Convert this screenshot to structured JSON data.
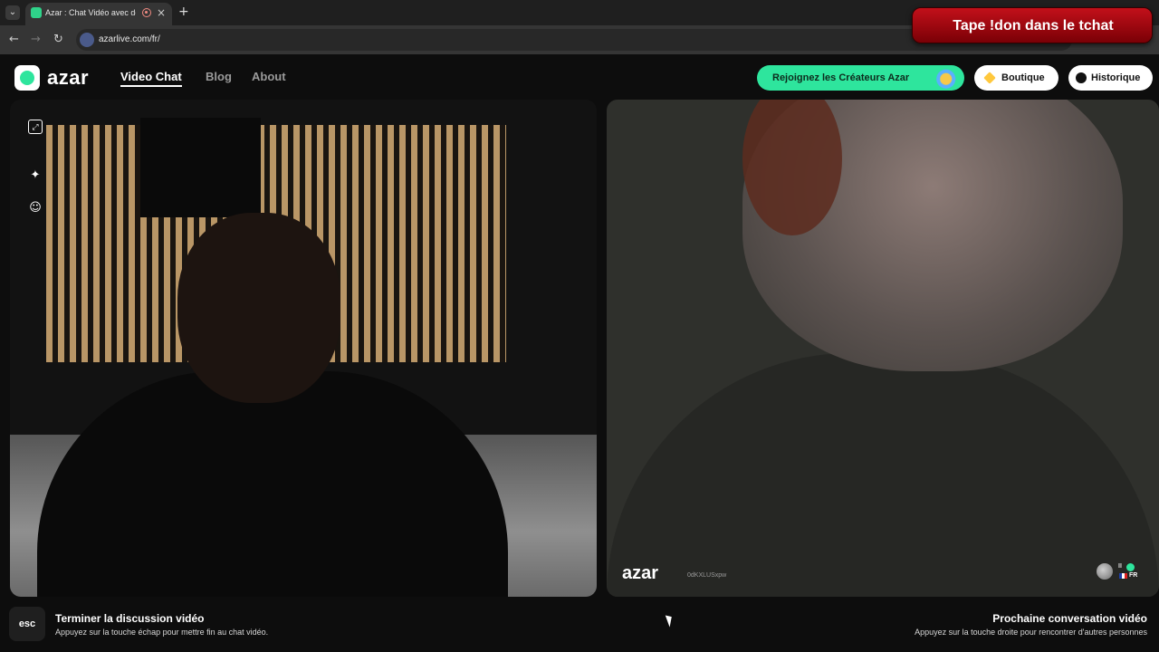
{
  "browser": {
    "tab_title": "Azar : Chat Vidéo avec de n",
    "url": "azarlive.com/fr/",
    "tab_list_icon": "chevron-down-icon",
    "new_tab_label": "+",
    "close_label": "×",
    "back_label": "←",
    "forward_label": "→",
    "reload_label": "↻"
  },
  "overlay": {
    "banner_text": "Tape !don dans le tchat"
  },
  "header": {
    "logo_text": "azar",
    "nav": [
      {
        "label": "Video Chat",
        "active": true
      },
      {
        "label": "Blog",
        "active": false
      },
      {
        "label": "About",
        "active": false
      }
    ],
    "creators_button": "Rejoignez les Créateurs Azar",
    "shop_button": "Boutique",
    "history_button": "Historique"
  },
  "video": {
    "local_tools": [
      "fullscreen-icon",
      "sparkle-effects-icon",
      "emoji-mask-icon"
    ],
    "remote_logo": "azar",
    "remote_user_id": "0dKXLUSxpw",
    "remote_pause_text": "II",
    "remote_country": "FR"
  },
  "footer": {
    "esc_key": "esc",
    "end_title": "Terminer la discussion vidéo",
    "end_description": "Appuyez sur la touche échap pour mettre fin au chat vidéo.",
    "next_title": "Prochaine conversation vidéo",
    "next_description": "Appuyez sur la touche droite pour rencontrer d'autres personnes"
  },
  "colors": {
    "brand_green": "#2ee59d",
    "banner_red": "#c2101a",
    "page_bg": "#0d0d0d"
  }
}
